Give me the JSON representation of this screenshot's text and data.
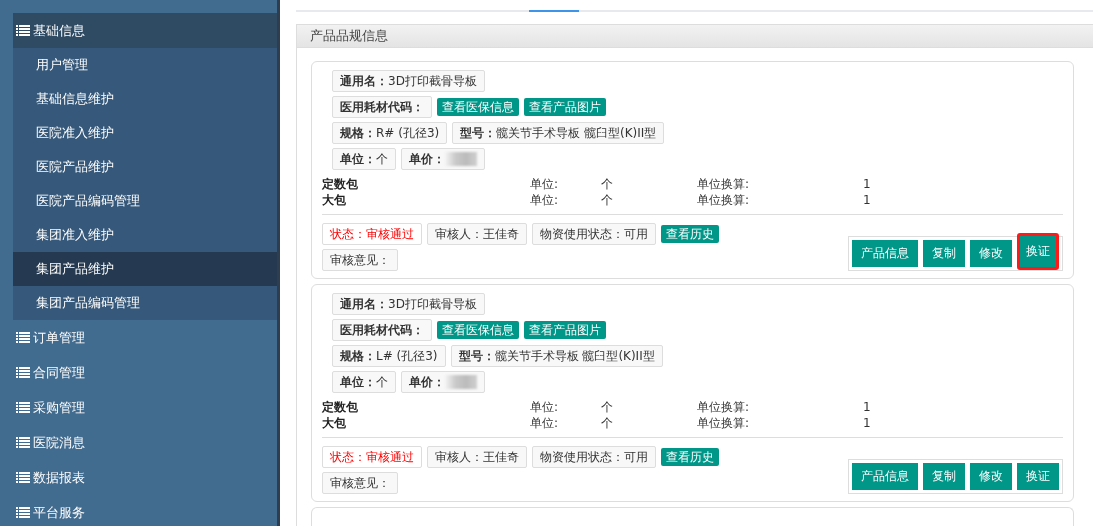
{
  "sidebar": {
    "menus": [
      {
        "label": "基础信息",
        "expanded": true,
        "children": [
          {
            "label": "用户管理",
            "selected": false
          },
          {
            "label": "基础信息维护",
            "selected": false
          },
          {
            "label": "医院准入维护",
            "selected": false
          },
          {
            "label": "医院产品维护",
            "selected": false
          },
          {
            "label": "医院产品编码管理",
            "selected": false
          },
          {
            "label": "集团准入维护",
            "selected": false
          },
          {
            "label": "集团产品维护",
            "selected": true
          },
          {
            "label": "集团产品编码管理",
            "selected": false
          }
        ]
      },
      {
        "label": "订单管理",
        "expanded": false
      },
      {
        "label": "合同管理",
        "expanded": false
      },
      {
        "label": "采购管理",
        "expanded": false
      },
      {
        "label": "医院消息",
        "expanded": false
      },
      {
        "label": "数据报表",
        "expanded": false
      },
      {
        "label": "平台服务",
        "expanded": false
      }
    ]
  },
  "panel": {
    "title": "产品品规信息",
    "cards": [
      {
        "lines": [
          {
            "items": [
              {
                "kind": "field",
                "text": "**通用名：**3D打印截骨导板"
              }
            ]
          },
          {
            "items": [
              {
                "kind": "field",
                "text": "**医用耗材代码：**"
              },
              {
                "kind": "button",
                "text": "查看医保信息"
              },
              {
                "kind": "button",
                "text": "查看产品图片"
              }
            ]
          },
          {
            "items": [
              {
                "kind": "field",
                "text": "**规格：**R# (孔径3)"
              },
              {
                "kind": "field",
                "text": "**型号：**髋关节手术导板 髋臼型(K)II型"
              }
            ]
          },
          {
            "items": [
              {
                "kind": "field",
                "text": "**单位：**个"
              },
              {
                "kind": "field",
                "text": "**单价：**",
                "redacted": true
              }
            ]
          }
        ],
        "packages": [
          {
            "name": "定数包",
            "unit_label": "单位:",
            "unit": "个",
            "conv_label": "单位换算:",
            "conv": "1"
          },
          {
            "name": "大包",
            "unit_label": "单位:",
            "unit": "个",
            "conv_label": "单位换算:",
            "conv": "1"
          }
        ],
        "status": [
          {
            "items": [
              {
                "kind": "status",
                "text": "状态：审核通过"
              },
              {
                "kind": "field",
                "text": "审核人：王佳奇"
              },
              {
                "kind": "field",
                "text": "物资使用状态：可用"
              },
              {
                "kind": "button",
                "text": "查看历史"
              }
            ]
          },
          {
            "items": [
              {
                "kind": "field",
                "text": "审核意见："
              }
            ]
          }
        ],
        "actions": [
          {
            "label": "产品信息",
            "highlighted": false
          },
          {
            "label": "复制",
            "highlighted": false
          },
          {
            "label": "修改",
            "highlighted": false
          },
          {
            "label": "换证",
            "highlighted": true
          }
        ]
      },
      {
        "lines": [
          {
            "items": [
              {
                "kind": "field",
                "text": "**通用名：**3D打印截骨导板"
              }
            ]
          },
          {
            "items": [
              {
                "kind": "field",
                "text": "**医用耗材代码：**"
              },
              {
                "kind": "button",
                "text": "查看医保信息"
              },
              {
                "kind": "button",
                "text": "查看产品图片"
              }
            ]
          },
          {
            "items": [
              {
                "kind": "field",
                "text": "**规格：**L# (孔径3)"
              },
              {
                "kind": "field",
                "text": "**型号：**髋关节手术导板 髋臼型(K)II型"
              }
            ]
          },
          {
            "items": [
              {
                "kind": "field",
                "text": "**单位：**个"
              },
              {
                "kind": "field",
                "text": "**单价：**",
                "redacted": true
              }
            ]
          }
        ],
        "packages": [
          {
            "name": "定数包",
            "unit_label": "单位:",
            "unit": "个",
            "conv_label": "单位换算:",
            "conv": "1"
          },
          {
            "name": "大包",
            "unit_label": "单位:",
            "unit": "个",
            "conv_label": "单位换算:",
            "conv": "1"
          }
        ],
        "status": [
          {
            "items": [
              {
                "kind": "status",
                "text": "状态：审核通过"
              },
              {
                "kind": "field",
                "text": "审核人：王佳奇"
              },
              {
                "kind": "field",
                "text": "物资使用状态：可用"
              },
              {
                "kind": "button",
                "text": "查看历史"
              }
            ]
          },
          {
            "items": [
              {
                "kind": "field",
                "text": "审核意见："
              }
            ]
          }
        ],
        "actions": [
          {
            "label": "产品信息",
            "highlighted": false
          },
          {
            "label": "复制",
            "highlighted": false
          },
          {
            "label": "修改",
            "highlighted": false
          },
          {
            "label": "换证",
            "highlighted": false
          }
        ]
      }
    ]
  }
}
